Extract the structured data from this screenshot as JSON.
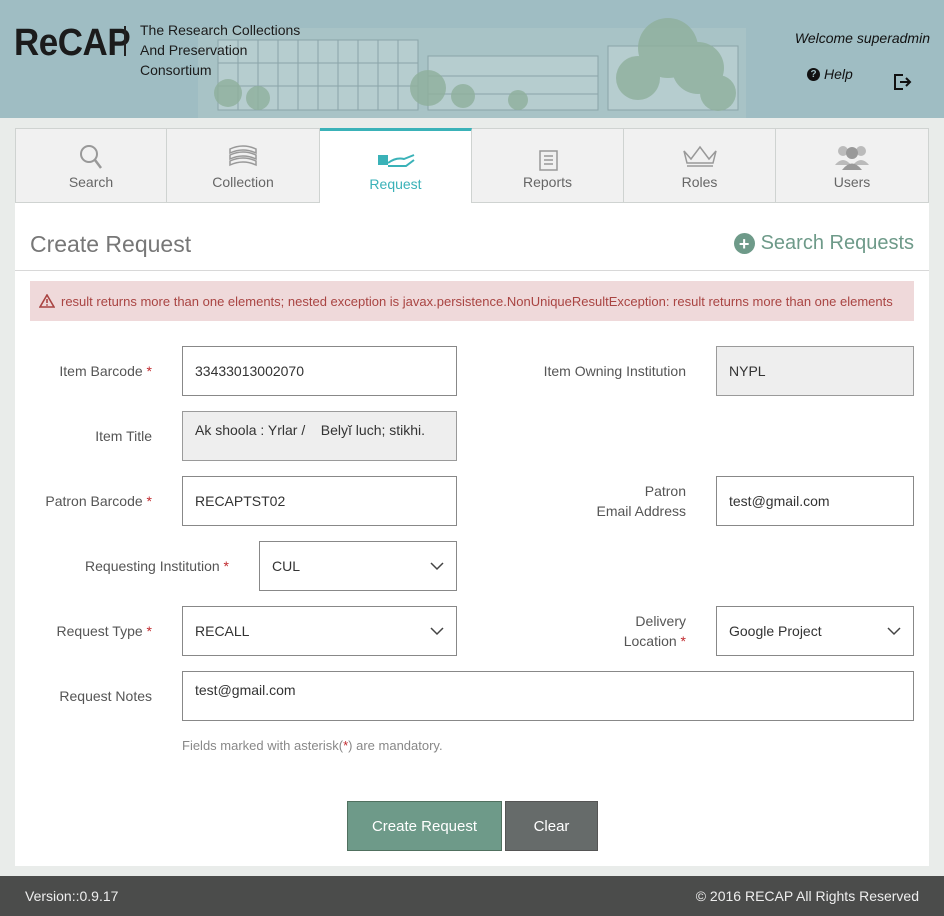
{
  "header": {
    "logo_text": "ReCAP",
    "tagline": "The Research Collections And Preservation Consortium",
    "welcome": "Welcome superadmin",
    "help_label": "Help",
    "help_icon": "question-circle-icon",
    "logout_icon": "logout-icon"
  },
  "tabs": [
    {
      "label": "Search",
      "icon": "search-icon",
      "active": false
    },
    {
      "label": "Collection",
      "icon": "books-icon",
      "active": false
    },
    {
      "label": "Request",
      "icon": "hand-book-icon",
      "active": true
    },
    {
      "label": "Reports",
      "icon": "document-icon",
      "active": false
    },
    {
      "label": "Roles",
      "icon": "crown-icon",
      "active": false
    },
    {
      "label": "Users",
      "icon": "users-icon",
      "active": false
    }
  ],
  "panel": {
    "title": "Create Request",
    "search_requests_label": "Search Requests"
  },
  "alert": {
    "message": "result returns more than one elements; nested exception is javax.persistence.NonUniqueResultException: result returns more than one elements"
  },
  "form": {
    "item_barcode": {
      "label": "Item Barcode",
      "value": "33433013002070"
    },
    "item_owning_institution": {
      "label": "Item Owning Institution",
      "value": "NYPL"
    },
    "item_title": {
      "label": "Item Title",
      "value": "Ak shoola : Yrlar /    Belyĭ luch; stikhi."
    },
    "patron_barcode": {
      "label": "Patron Barcode",
      "value": "RECAPTST02"
    },
    "patron_email": {
      "label_line1": "Patron",
      "label_line2": "Email Address",
      "value": "test@gmail.com"
    },
    "requesting_institution": {
      "label": "Requesting Institution",
      "value": "CUL"
    },
    "request_type": {
      "label": "Request Type",
      "value": "RECALL"
    },
    "delivery_location": {
      "label_line1": "Delivery",
      "label_line2": "Location",
      "value": "Google Project"
    },
    "request_notes": {
      "label": "Request Notes",
      "value": "test@gmail.com"
    },
    "mandatory_note_prefix": "Fields marked with asterisk(",
    "mandatory_note_star": "*",
    "mandatory_note_suffix": ") are mandatory."
  },
  "buttons": {
    "create": "Create Request",
    "clear": "Clear"
  },
  "footer": {
    "version": "Version::0.9.17",
    "copyright": "© 2016 RECAP All Rights Reserved"
  },
  "colors": {
    "header_bg": "#9fbdc3",
    "accent_teal": "#3ab2b8",
    "green": "#6e9a89",
    "alert_bg": "#efd9da",
    "alert_text": "#a94442",
    "footer_bg": "#4b4c4b"
  }
}
